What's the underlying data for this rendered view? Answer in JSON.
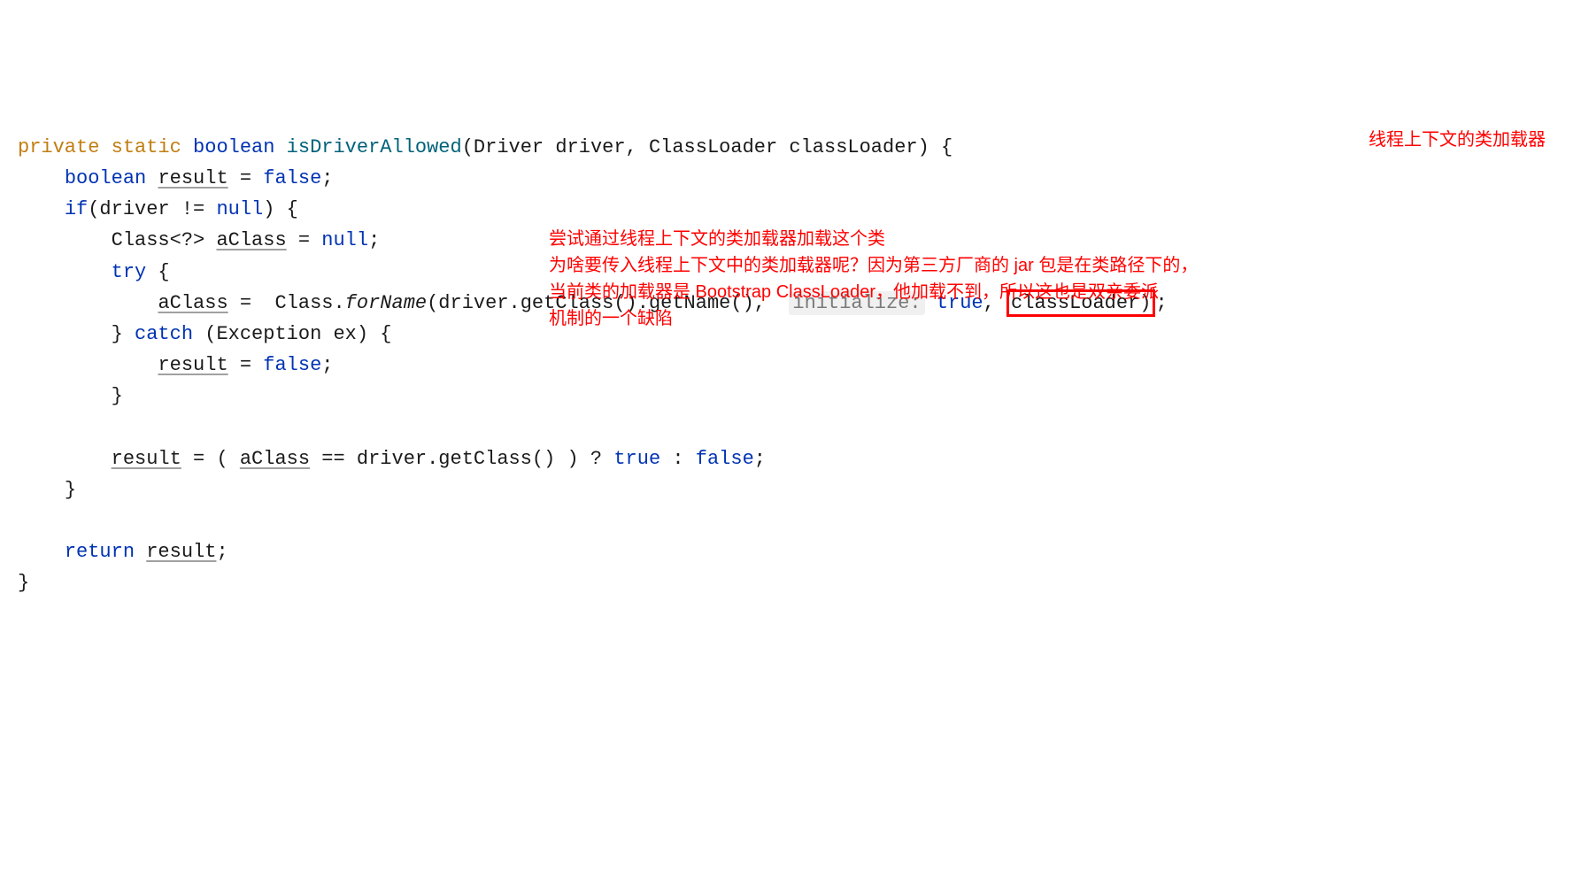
{
  "code": {
    "kw_private": "private",
    "kw_static": "static",
    "kw_boolean": "boolean",
    "method_name": "isDriverAllowed",
    "sig_params": "(Driver driver, ClassLoader classLoader) {",
    "line2_boolean": "boolean",
    "line2_result": "result",
    "line2_eq": " = ",
    "line2_false": "false",
    "line2_semi": ";",
    "line3_if": "if",
    "line3_cond": "(driver != ",
    "line3_null": "null",
    "line3_after": ") {",
    "line4_class_decl": "Class<?> ",
    "line4_aclass": "aClass",
    "line4_eq": " = ",
    "line4_null": "null",
    "line4_semi": ";",
    "line5_try": "try",
    "line5_brace": " {",
    "line6_aclass": "aClass",
    "line6_eq": " =  Class.",
    "line6_forname": "forName",
    "line6_args1": "(driver.getClass().getName(), ",
    "line6_hint": "initialize:",
    "line6_true": "true",
    "line6_comma": ", ",
    "line6_classloader": "classLoader)",
    "line6_semi": ";",
    "line7_close": "} ",
    "line7_catch": "catch",
    "line7_params": " (Exception ex) {",
    "line8_result": "result",
    "line8_eq": " = ",
    "line8_false": "false",
    "line8_semi": ";",
    "line9_close": "}",
    "line11_result": "result",
    "line11_eq1": " = ( ",
    "line11_aclass": "aClass",
    "line11_eq2": " == driver.getClass() ) ? ",
    "line11_true": "true",
    "line11_colon": " : ",
    "line11_false": "false",
    "line11_semi": ";",
    "line12_close": "}",
    "line14_return": "return",
    "line14_sp": " ",
    "line14_result": "result",
    "line14_semi": ";",
    "line15_close": "}"
  },
  "annotations": {
    "top_label": "线程上下文的类加载器",
    "mid_line1": "尝试通过线程上下文的类加载器加载这个类",
    "mid_line2": "为啥要传入线程上下文中的类加载器呢？因为第三方厂商的 jar 包是在类路径下的，",
    "mid_line3": "当前类的加载器是 Bootstrap ClassLoader，他加载不到，所以这也是双亲委派",
    "mid_line4": "机制的一个缺陷"
  }
}
